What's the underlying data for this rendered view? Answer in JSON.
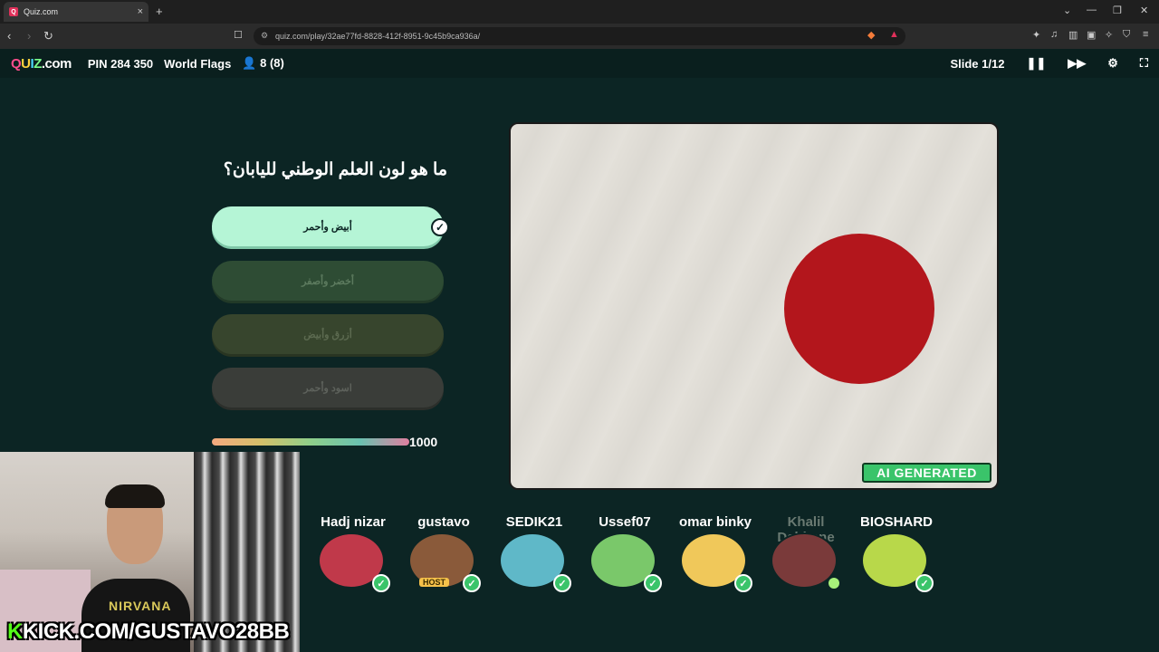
{
  "browser": {
    "tab_title": "Quiz.com",
    "tab_close": "×",
    "new_tab": "+",
    "url": "quiz.com/play/32ae77fd-8828-412f-8951-9c45b9ca936a/"
  },
  "header": {
    "logo": {
      "q": "Q",
      "u": "U",
      "i": "I",
      "z": "Z",
      "rest": ".com"
    },
    "pin": "PIN 284 350",
    "quiz_title": "World Flags",
    "players_count": "8 (8)",
    "slide": "Slide 1/12"
  },
  "question": {
    "text": "ما هو لون العلم الوطني لليابان؟",
    "answers": [
      {
        "label": "أبيض وأحمر",
        "correct": true
      },
      {
        "label": "أخضر وأصفر",
        "correct": false
      },
      {
        "label": "أزرق وأبيض",
        "correct": false
      },
      {
        "label": "اسود وأحمر",
        "correct": false
      }
    ],
    "check_mark": "✓",
    "points": "1000"
  },
  "image": {
    "badge": "AI GENERATED",
    "flag_bg": "#e3e0d9",
    "sun_color": "#b3161c"
  },
  "players": [
    {
      "name": "Hadj nizar",
      "status": "answered",
      "color": "#c0394a"
    },
    {
      "name": "gustavo",
      "status": "answered",
      "host": "HOST",
      "color": "#8a5a3a"
    },
    {
      "name": "SEDIK21",
      "status": "answered",
      "color": "#5fb8c8"
    },
    {
      "name": "Ussef07",
      "status": "answered",
      "color": "#7ac86a"
    },
    {
      "name": "omar binky",
      "status": "answered",
      "color": "#f0c85a"
    },
    {
      "name": "Khalil Dahhane",
      "status": "waiting",
      "color": "#7a3a3a"
    },
    {
      "name": "BIOSHARD",
      "status": "answered",
      "color": "#b8d84a"
    }
  ],
  "stream": {
    "overlay_k": "K",
    "overlay_text": "KICK.COM/GUSTAVO28BB",
    "shirt_text": "NIRVANA"
  }
}
